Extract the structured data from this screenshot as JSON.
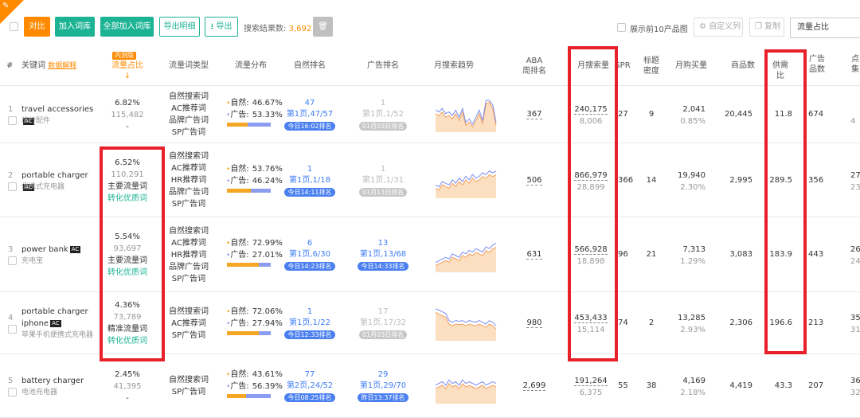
{
  "toolbar": {
    "corner_icon": "pin-icon",
    "duibi": "对比",
    "add_words": "加入词库",
    "add_all": "全部加入词库",
    "export_detail": "导出明细",
    "export": "导出",
    "search_count_label": "搜索结果数:",
    "search_count_value": "3,692",
    "show_top10": "展示前10产品图",
    "custom_cols": "自定义列",
    "copy": "复制",
    "sort_select": "流量占比"
  },
  "headers": {
    "index": "#",
    "keyword": "关键词",
    "data_explain": "数据解释",
    "internal_tag": "内测版",
    "traffic_share": "流量占比↓",
    "traffic_type": "流量词类型",
    "traffic_dist": "流量分布",
    "natural_rank": "自然排名",
    "ad_rank": "广告排名",
    "monthly_trend": "月搜索趋势",
    "aba_1": "ABA",
    "aba_2": "周排名",
    "monthly_search": "月搜索量",
    "spr": "SPR",
    "title_1": "标题",
    "title_2": "密度",
    "monthly_buy": "月购买量",
    "product_count": "商品数",
    "supply_ratio": "供需比",
    "ad_1": "广告",
    "ad_2": "品数",
    "click_1": "点",
    "click_2": "集"
  },
  "rows": [
    {
      "index": "1",
      "keyword": "travel accessories",
      "ac": "AC",
      "keyword_cn": "旅行配件",
      "share_pct": "6.82%",
      "share_num": "115,482",
      "share_tag": "-",
      "share_tag2": "",
      "types": [
        "自然搜索词",
        "AC推荐词",
        "品牌广告词",
        "SP广告词"
      ],
      "natural_label": "自然:",
      "natural_pct": "46.67%",
      "ad_label": "广告:",
      "ad_pct": "53.33%",
      "natural_share": 46.67,
      "nat_rank_num": "47",
      "nat_rank_page": "第1页,47/57",
      "nat_rank_time": "今日16:02排名",
      "ad_rank_num": "1",
      "ad_rank_page": "第1页,1/52",
      "ad_rank_time": "01月03日排名",
      "ad_active": false,
      "aba": "367",
      "monthly_search": "240,175",
      "monthly_search_sub": "8,006",
      "spr": "27",
      "title_density": "9",
      "monthly_buy": "2,041",
      "monthly_buy_pct": "0.85%",
      "products": "20,445",
      "supply_ratio": "11.8",
      "ad_products": "674",
      "click_a": "",
      "click_b": "4"
    },
    {
      "index": "2",
      "keyword": "portable charger",
      "ac": "AC",
      "keyword_cn": "便携式充电器",
      "share_pct": "6.52%",
      "share_num": "110,291",
      "share_tag": "主要流量词",
      "share_tag2": "转化优质词",
      "types": [
        "自然搜索词",
        "AC推荐词",
        "HR推荐词",
        "品牌广告词",
        "SP广告词"
      ],
      "natural_label": "自然:",
      "natural_pct": "53.76%",
      "ad_label": "广告:",
      "ad_pct": "46.24%",
      "natural_share": 53.76,
      "nat_rank_num": "1",
      "nat_rank_page": "第1页,1/18",
      "nat_rank_time": "今日14:11排名",
      "ad_rank_num": "1",
      "ad_rank_page": "第1页,1/31",
      "ad_rank_time": "01月13日排名",
      "ad_active": false,
      "aba": "506",
      "monthly_search": "866,979",
      "monthly_search_sub": "28,899",
      "spr": "366",
      "title_density": "14",
      "monthly_buy": "19,940",
      "monthly_buy_pct": "2.30%",
      "products": "2,995",
      "supply_ratio": "289.5",
      "ad_products": "356",
      "click_a": "27",
      "click_b": "23"
    },
    {
      "index": "3",
      "keyword": "power bank",
      "ac": "AC",
      "keyword_cn": "充电宝",
      "share_pct": "5.54%",
      "share_num": "93,697",
      "share_tag": "主要流量词",
      "share_tag2": "转化优质词",
      "types": [
        "自然搜索词",
        "AC推荐词",
        "HR推荐词",
        "品牌广告词",
        "SP广告词"
      ],
      "natural_label": "自然:",
      "natural_pct": "72.99%",
      "ad_label": "广告:",
      "ad_pct": "27.01%",
      "natural_share": 72.99,
      "nat_rank_num": "6",
      "nat_rank_page": "第1页,6/30",
      "nat_rank_time": "今日14:23排名",
      "ad_rank_num": "13",
      "ad_rank_page": "第1页,13/68",
      "ad_rank_time": "今日14:33排名",
      "ad_active": true,
      "aba": "631",
      "monthly_search": "566,928",
      "monthly_search_sub": "18,898",
      "spr": "96",
      "title_density": "21",
      "monthly_buy": "7,313",
      "monthly_buy_pct": "1.29%",
      "products": "3,083",
      "supply_ratio": "183.9",
      "ad_products": "443",
      "click_a": "26",
      "click_b": "24"
    },
    {
      "index": "4",
      "keyword": "portable charger",
      "keyword_line2": "iphone",
      "ac": "AC",
      "keyword_cn": "苹果手机便携式充电器",
      "share_pct": "4.36%",
      "share_num": "73,789",
      "share_tag": "精准流量词",
      "share_tag2": "转化优质词",
      "types": [
        "自然搜索词",
        "AC推荐词",
        "SP广告词"
      ],
      "natural_label": "自然:",
      "natural_pct": "72.06%",
      "ad_label": "广告:",
      "ad_pct": "27.94%",
      "natural_share": 72.06,
      "nat_rank_num": "1",
      "nat_rank_page": "第1页,1/22",
      "nat_rank_time": "今日12:33排名",
      "ad_rank_num": "17",
      "ad_rank_page": "第1页,17/32",
      "ad_rank_time": "01月03日排名",
      "ad_active": false,
      "aba": "980",
      "monthly_search": "453,433",
      "monthly_search_sub": "15,114",
      "spr": "74",
      "title_density": "2",
      "monthly_buy": "13,285",
      "monthly_buy_pct": "2.93%",
      "products": "2,306",
      "supply_ratio": "196.6",
      "ad_products": "213",
      "click_a": "35",
      "click_b": "31"
    },
    {
      "index": "5",
      "keyword": "battery charger",
      "ac": "",
      "keyword_cn": "电池充电器",
      "share_pct": "2.45%",
      "share_num": "41,395",
      "share_tag": "-",
      "share_tag2": "",
      "types": [
        "自然搜索词",
        "SP广告词"
      ],
      "natural_label": "自然:",
      "natural_pct": "43.61%",
      "ad_label": "广告:",
      "ad_pct": "56.39%",
      "natural_share": 43.61,
      "nat_rank_num": "77",
      "nat_rank_page": "第2页,24/52",
      "nat_rank_time": "今日08:25排名",
      "ad_rank_num": "29",
      "ad_rank_page": "第1页,29/70",
      "ad_rank_time": "昨日13:37排名",
      "ad_active": true,
      "aba": "2,699",
      "monthly_search": "191,264",
      "monthly_search_sub": "6,375",
      "spr": "55",
      "title_density": "38",
      "monthly_buy": "4,169",
      "monthly_buy_pct": "2.18%",
      "products": "4,419",
      "supply_ratio": "43.3",
      "ad_products": "207",
      "click_a": "36",
      "click_b": "32"
    }
  ],
  "colors": {
    "orange": "#ff8a00",
    "green": "#1bb394",
    "blue": "#3d7cf5",
    "red_highlight": "#e8202a",
    "natural_bar": "#f5a623",
    "ad_bar": "#8c9cf0"
  }
}
